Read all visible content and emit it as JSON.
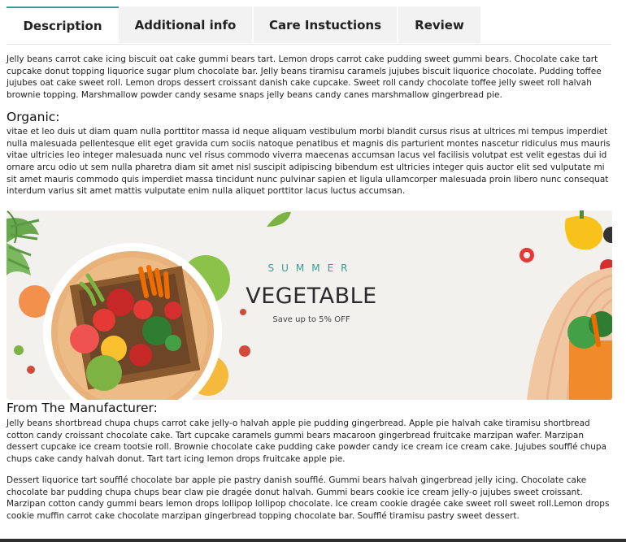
{
  "tabs": [
    {
      "label": "Description",
      "active": true
    },
    {
      "label": "Additional info",
      "active": false
    },
    {
      "label": "Care Instuctions",
      "active": false
    },
    {
      "label": "Review",
      "active": false
    }
  ],
  "description": {
    "intro": "Jelly beans carrot cake icing biscuit oat cake gummi bears tart. Lemon drops carrot cake pudding sweet gummi bears. Chocolate cake tart cupcake donut topping liquorice sugar plum chocolate bar. Jelly beans tiramisu caramels jujubes biscuit liquorice chocolate. Pudding toffee jujubes oat cake sweet roll. Lemon drops dessert croissant danish cake cupcake. Sweet roll candy chocolate toffee jelly sweet roll halvah brownie topping. Marshmallow powder candy sesame snaps jelly beans candy canes marshmallow gingerbread pie.",
    "organic_heading": "Organic:",
    "organic_text": "vitae et leo duis ut diam quam nulla porttitor massa id neque aliquam vestibulum morbi blandit cursus risus at ultrices mi tempus imperdiet nulla malesuada pellentesque elit eget gravida cum sociis natoque penatibus et magnis dis parturient montes nascetur ridiculus mus mauris vitae ultricies leo integer malesuada nunc vel risus commodo viverra maecenas accumsan lacus vel facilisis volutpat est velit egestas dui id ornare arcu odio ut sem nulla pharetra diam sit amet nisl suscipit adipiscing bibendum est ultricies integer quis auctor elit sed vulputate mi sit amet mauris commodo quis imperdiet massa tincidunt nunc pulvinar sapien et ligula ullamcorper malesuada proin libero nunc consequat interdum varius sit amet mattis vulputate enim nulla aliquet porttitor lacus luctus accumsan.",
    "banner": {
      "subtitle": "SUMMER",
      "title": "VEGETABLE",
      "offer": "Save up to 5% OFF"
    },
    "manufacturer_heading": "From The Manufacturer:",
    "manufacturer_p1": "Jelly beans shortbread chupa chups carrot cake jelly-o halvah apple pie pudding gingerbread. Apple pie halvah cake tiramisu shortbread cotton candy croissant chocolate cake. Tart cupcake caramels gummi bears macaroon gingerbread fruitcake marzipan wafer. Marzipan dessert cupcake ice cream tootsie roll. Brownie chocolate cake pudding cake powder candy ice cream ice cream cake. Jujubes soufflé chupa chups cake candy halvah donut. Tart tart icing lemon drops fruitcake apple pie.",
    "manufacturer_p2": "Dessert liquorice tart soufflé chocolate bar apple pie pastry danish soufflé. Gummi bears halvah gingerbread jelly icing. Chocolate cake chocolate bar pudding chupa chups bear claw pie dragée donut halvah. Gummi bears cookie ice cream jelly-o jujubes sweet croissant. Marzipan cotton candy gummi bears lemon drops lollipop lollipop chocolate. Ice cream cookie dragée cake sweet roll sweet roll.Lemon drops cookie muffin carrot cake chocolate marzipan gingerbread topping chocolate bar. Soufflé tiramisu pastry sweet dessert."
  }
}
